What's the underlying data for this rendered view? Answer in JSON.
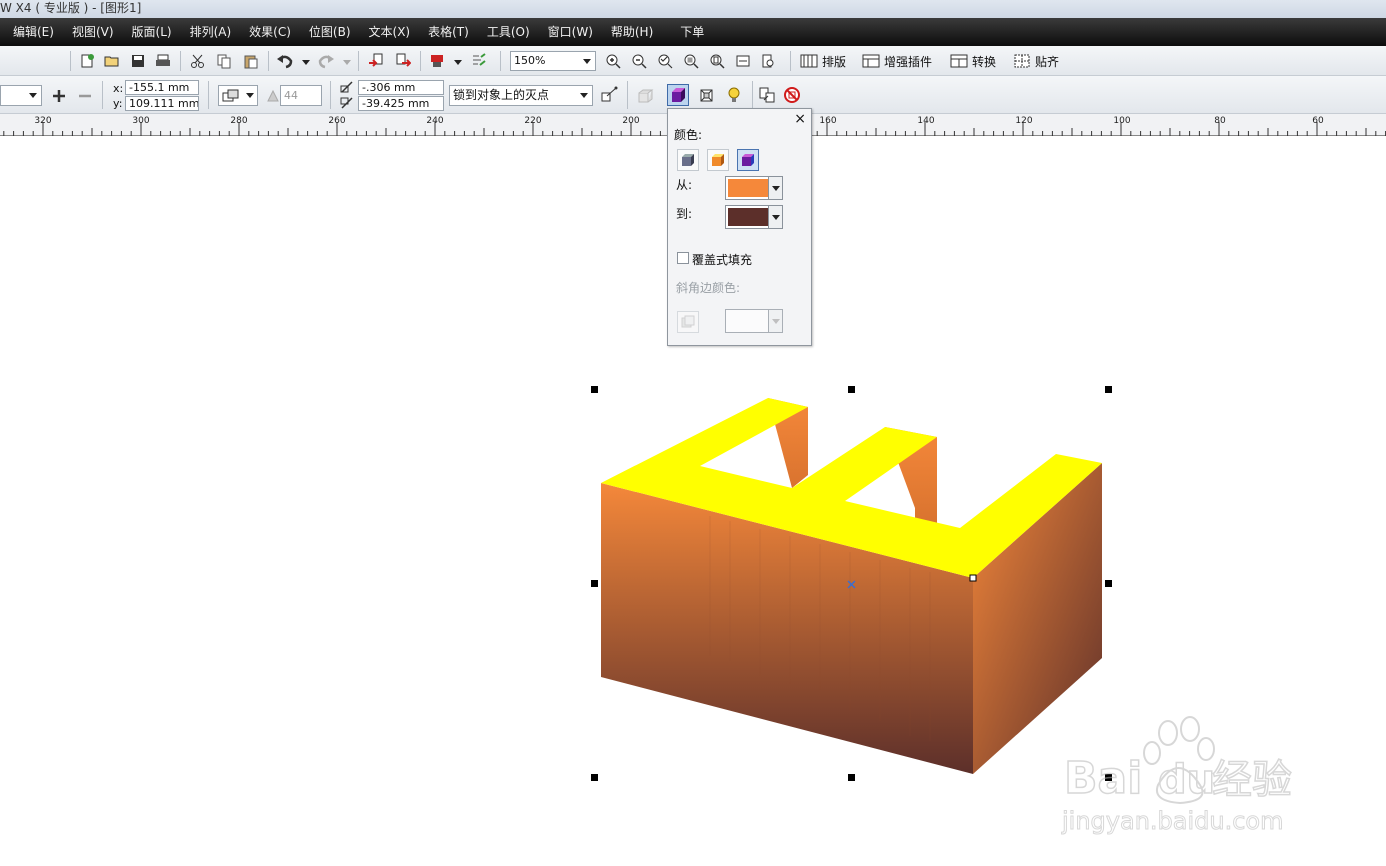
{
  "title": "W X4 ( 专业版 ) - [图形1]",
  "menu": [
    "编辑(E)",
    "视图(V)",
    "版面(L)",
    "排列(A)",
    "效果(C)",
    "位图(B)",
    "文本(X)",
    "表格(T)",
    "工具(O)",
    "窗口(W)",
    "帮助(H)",
    "下单"
  ],
  "toolbar": {
    "zoom": "150%",
    "paiban": "排版",
    "plugin": "增强插件",
    "convert": "转换",
    "snap": "贴齐"
  },
  "propbar": {
    "x_label": "x:",
    "x_value": "-155.1 mm",
    "y_label": "y:",
    "y_value": "109.111 mm",
    "depth": "44",
    "vp_x": "-.306 mm",
    "vp_y": "-39.425 mm",
    "lock_mode": "锁到对象上的灭点"
  },
  "ruler": [
    "320",
    "300",
    "280",
    "260",
    "240",
    "220",
    "200",
    "160",
    "140",
    "120",
    "100",
    "80",
    "60"
  ],
  "color_panel": {
    "heading": "颜色:",
    "from_label": "从:",
    "to_label": "到:",
    "from_color": "#F5883A",
    "to_color": "#5C2F2A",
    "overlay_fill": "覆盖式填充",
    "bevel_color": "斜角边颜色:",
    "close": "×"
  },
  "object": {
    "face_top_color": "#FFFF00",
    "front_from": "#F5883A",
    "front_to": "#5C2F2A"
  },
  "watermark": {
    "brand_left": "Bai",
    "brand_right": "du",
    "brand_cn": "经验",
    "url": "jingyan.baidu.com"
  }
}
